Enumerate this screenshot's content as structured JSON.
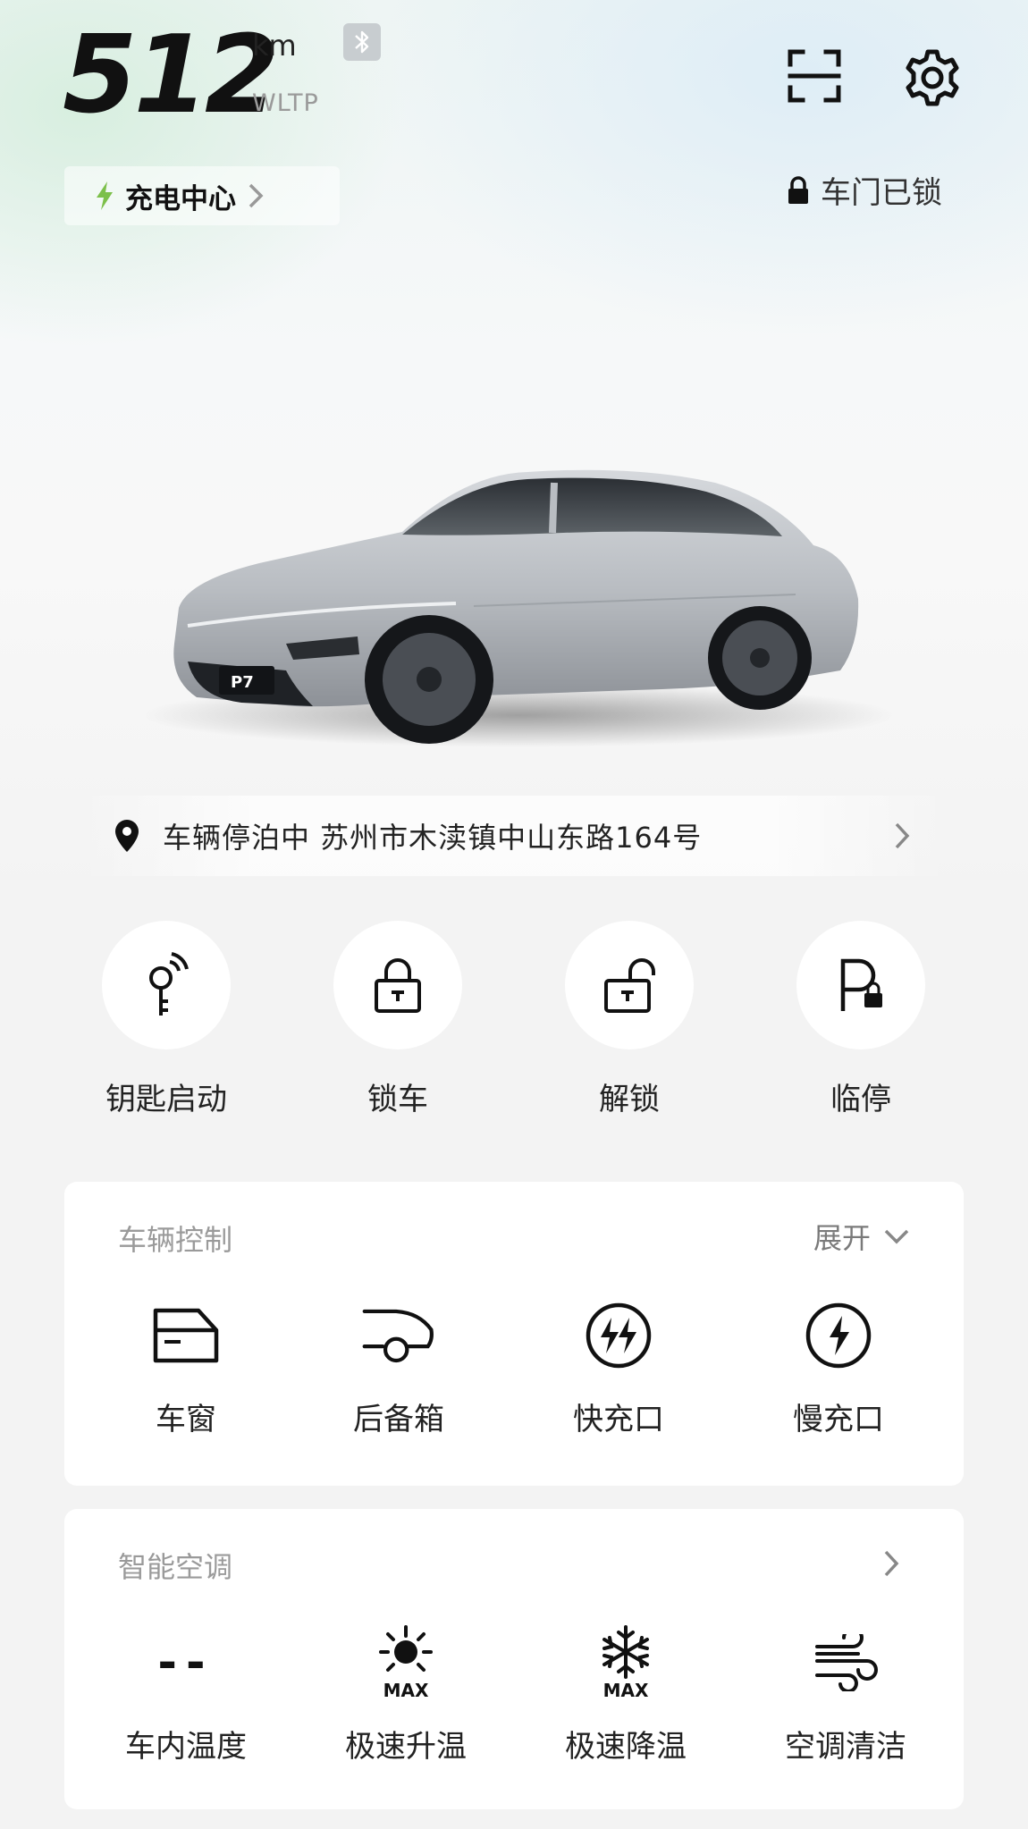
{
  "header": {
    "range_value": "512",
    "range_unit": "km",
    "range_standard": "WLTP"
  },
  "charging_center": {
    "label": "充电中心",
    "accent": "#7cc04a"
  },
  "door_status": {
    "label": "车门已锁"
  },
  "car": {
    "plate": "P7"
  },
  "location": {
    "text": "车辆停泊中 苏州市木渎镇中山东路164号"
  },
  "quick_actions": [
    {
      "label": "钥匙启动",
      "icon": "key-wireless-icon"
    },
    {
      "label": "锁车",
      "icon": "lock-icon"
    },
    {
      "label": "解锁",
      "icon": "unlock-icon"
    },
    {
      "label": "临停",
      "icon": "parking-lock-icon"
    }
  ],
  "vehicle_control": {
    "title": "车辆控制",
    "toggle_label": "展开",
    "items": [
      {
        "label": "车窗",
        "icon": "window-icon"
      },
      {
        "label": "后备箱",
        "icon": "trunk-icon"
      },
      {
        "label": "快充口",
        "icon": "fast-charge-port-icon"
      },
      {
        "label": "慢充口",
        "icon": "slow-charge-port-icon"
      }
    ]
  },
  "climate": {
    "title": "智能空调",
    "items": [
      {
        "label": "车内温度",
        "value": "--",
        "icon": "cabin-temperature"
      },
      {
        "label": "极速升温",
        "icon": "max-heat-icon",
        "badge": "MAX"
      },
      {
        "label": "极速降温",
        "icon": "max-cool-icon",
        "badge": "MAX"
      },
      {
        "label": "空调清洁",
        "icon": "ac-clean-icon"
      }
    ]
  }
}
